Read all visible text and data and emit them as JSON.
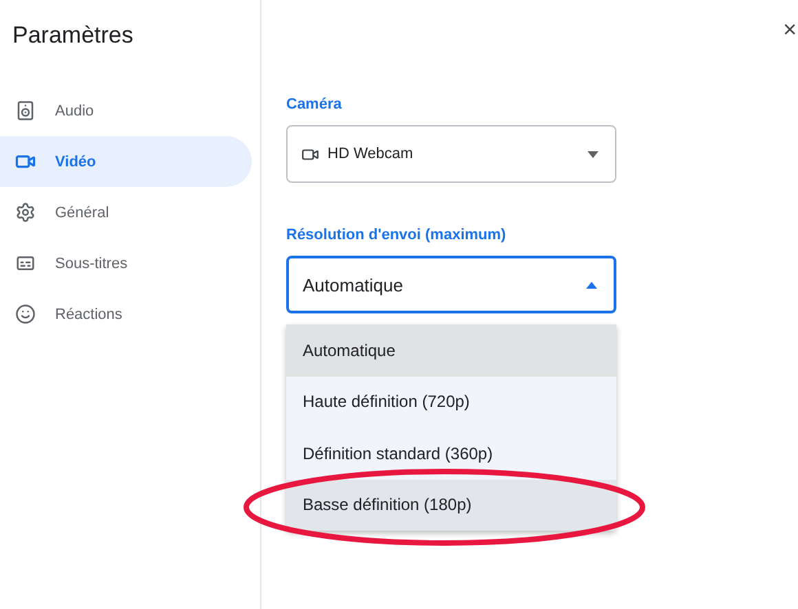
{
  "sidebar": {
    "title": "Paramètres",
    "items": [
      {
        "kind": "audio",
        "label": "Audio",
        "selected": false
      },
      {
        "kind": "video",
        "label": "Vidéo",
        "selected": true
      },
      {
        "kind": "general",
        "label": "Général",
        "selected": false
      },
      {
        "kind": "captions",
        "label": "Sous-titres",
        "selected": false
      },
      {
        "kind": "reactions",
        "label": "Réactions",
        "selected": false
      }
    ]
  },
  "close": "×",
  "camera": {
    "label": "Caméra",
    "value": "HD Webcam"
  },
  "resolution": {
    "label": "Résolution d'envoi (maximum)",
    "value": "Automatique",
    "expanded": true,
    "options": [
      {
        "label": "Automatique",
        "selected": true,
        "hovered": false,
        "circled": false
      },
      {
        "label": "Haute définition (720p)",
        "selected": false,
        "hovered": false,
        "circled": false
      },
      {
        "label": "Définition standard (360p)",
        "selected": false,
        "hovered": false,
        "circled": false
      },
      {
        "label": "Basse définition (180p)",
        "selected": false,
        "hovered": true,
        "circled": true
      }
    ]
  }
}
